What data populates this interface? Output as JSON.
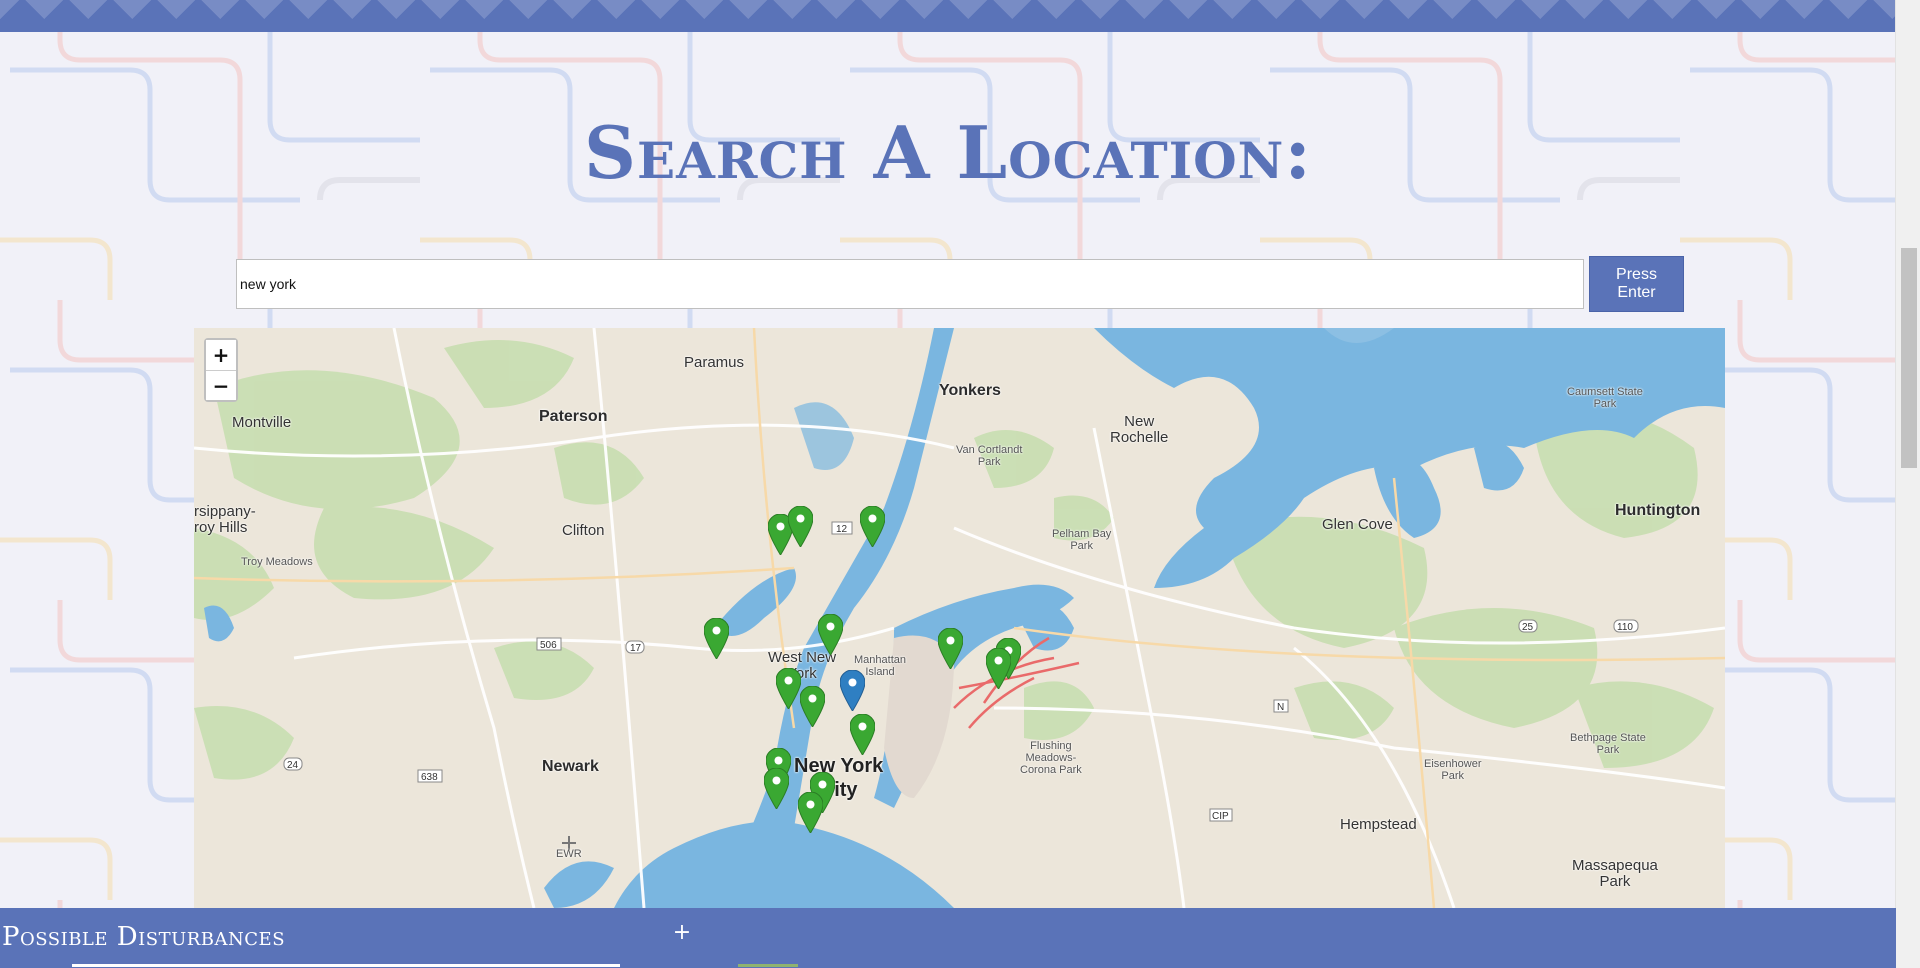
{
  "page": {
    "title": "Search A Location:"
  },
  "search": {
    "value": "new york",
    "button_label": "Press Enter"
  },
  "map": {
    "zoom_in": "+",
    "zoom_out": "−",
    "places": {
      "paramus": "Paramus",
      "yonkers": "Yonkers",
      "montville": "Montville",
      "paterson": "Paterson",
      "new_rochelle": "New\nRochelle",
      "caumsett": "Caumsett State\nPark",
      "parsippany": "rsippany-\nroy Hills",
      "clifton": "Clifton",
      "van_cortlandt": "Van Cortlandt\nPark",
      "pelham": "Pelham Bay\nPark",
      "glen_cove": "Glen Cove",
      "huntington": "Huntington",
      "troy_meadows": "Troy Meadows",
      "west_new_york": "West New\nYork",
      "manhattan": "Manhattan\nIsland",
      "newark": "Newark",
      "new_york_city": "New York\nCity",
      "flushing": "Flushing\nMeadows-\nCorona Park",
      "eisenhower": "Eisenhower\nPark",
      "bethpage": "Bethpage State\nPark",
      "hempstead": "Hempstead",
      "massapequa": "Massapequa\nPark",
      "ewr": "EWR"
    },
    "route_shields": [
      "12",
      "506",
      "17",
      "24",
      "638",
      "25",
      "110",
      "N",
      "CIP"
    ],
    "marker_color": "#3aa832",
    "selected_marker_color": "#2f7fc2"
  },
  "disturbances": {
    "title": "Possible Disturbances",
    "toggle": "+"
  },
  "colors": {
    "accent": "#5a73b8",
    "water": "#7ab6e0",
    "land": "#ece6da",
    "park": "#c8deb0"
  }
}
